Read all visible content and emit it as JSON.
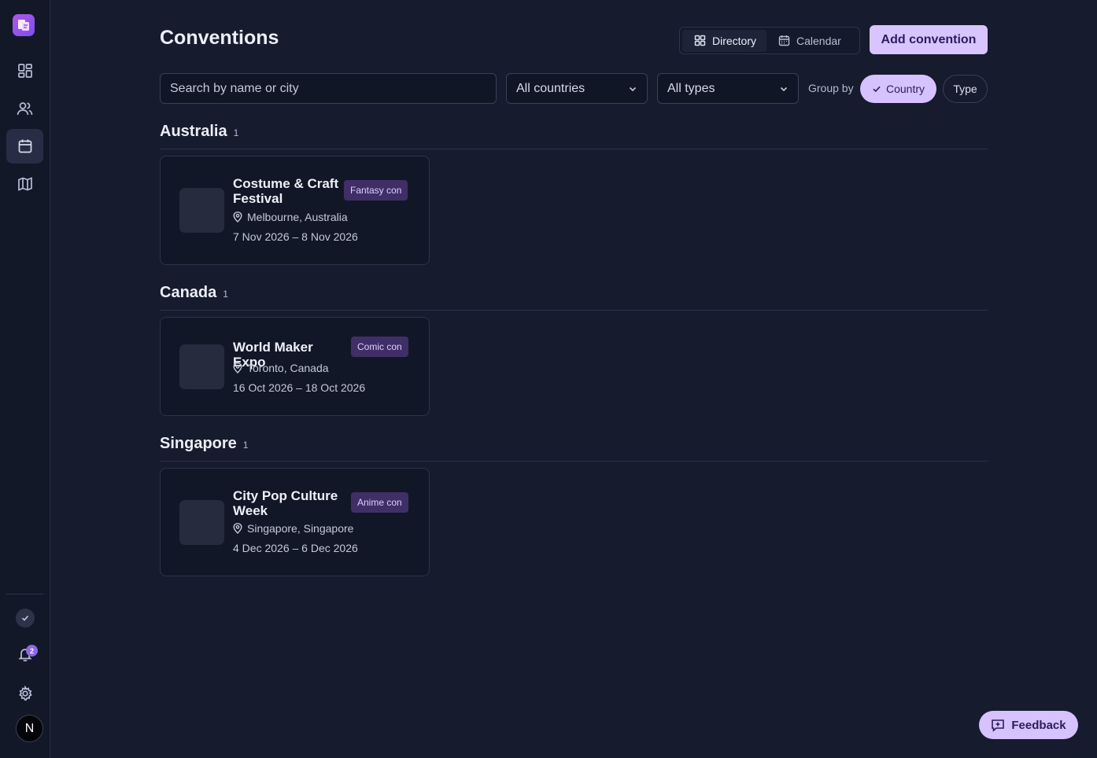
{
  "page": {
    "title": "Conventions"
  },
  "view_toggle": {
    "directory": "Directory",
    "calendar": "Calendar"
  },
  "actions": {
    "add_label": "Add convention"
  },
  "filters": {
    "search_placeholder": "Search by name or city",
    "country": "All countries",
    "type": "All types",
    "group_by_label": "Group by",
    "group_by_options": [
      "Country",
      "Type"
    ],
    "group_by_selected": "Country"
  },
  "groups": [
    {
      "name": "Australia",
      "count": "1",
      "items": [
        {
          "title": "Costume & Craft Festival",
          "badge": "Fantasy con",
          "location": "Melbourne, Australia",
          "dates": "7 Nov 2026 – 8 Nov 2026"
        }
      ]
    },
    {
      "name": "Canada",
      "count": "1",
      "items": [
        {
          "title": "World Maker Expo",
          "badge": "Comic con",
          "location": "Toronto, Canada",
          "dates": "16 Oct 2026 – 18 Oct 2026"
        }
      ]
    },
    {
      "name": "Singapore",
      "count": "1",
      "items": [
        {
          "title": "City Pop Culture Week",
          "badge": "Anime con",
          "location": "Singapore, Singapore",
          "dates": "4 Dec 2026 – 6 Dec 2026"
        }
      ]
    }
  ],
  "sidebar": {
    "nav": [
      {
        "icon": "dashboard-icon"
      },
      {
        "icon": "people-icon"
      },
      {
        "icon": "calendar-icon",
        "active": true
      },
      {
        "icon": "map-icon"
      }
    ],
    "notification_count": "2",
    "avatar_initial": "N"
  },
  "feedback": {
    "label": "Feedback"
  },
  "colors": {
    "accent": "#d8c4ff",
    "background": "#161b2e",
    "badge": "#3f2f66"
  }
}
